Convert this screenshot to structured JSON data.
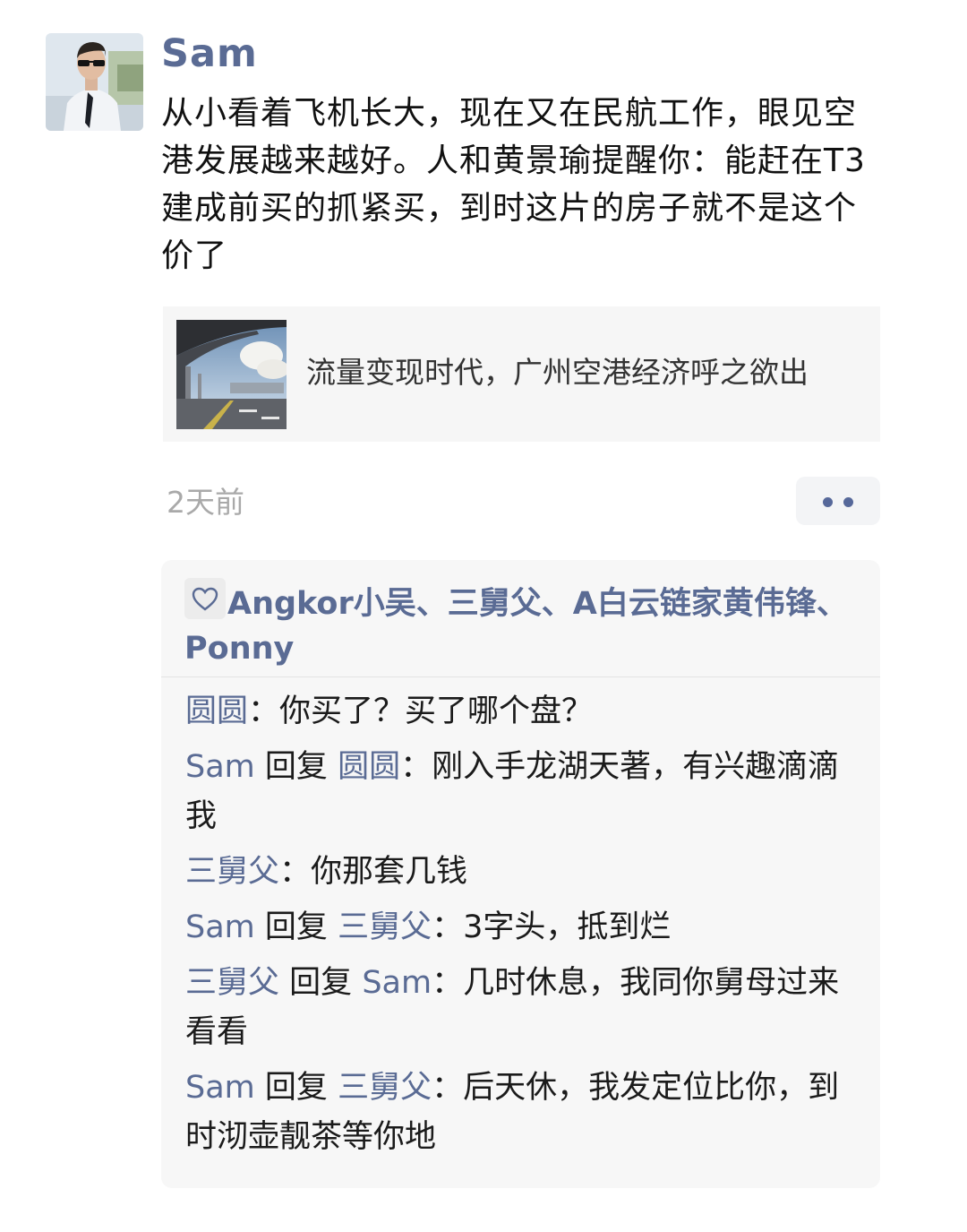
{
  "post": {
    "author": "Sam",
    "text": "从小看着飞机长大，现在又在民航工作，眼见空港发展越来越好。人和黄景瑜提醒你：能赶在T3建成前买的抓紧买，到时这片的房子就不是这个价了",
    "link_title": "流量变现时代，广州空港经济呼之欲出",
    "time": "2天前"
  },
  "likes": {
    "names": [
      "Angkor小吴",
      "三舅父",
      "A白云链家黄伟锋",
      "Ponny"
    ],
    "separator": "、"
  },
  "comments": {
    "reply_word": "回复",
    "colon": "：",
    "items": [
      {
        "from": "圆圆",
        "to": "",
        "text": "你买了？买了哪个盘？"
      },
      {
        "from": "Sam",
        "to": "圆圆",
        "text": "刚入手龙湖天著，有兴趣滴滴我"
      },
      {
        "from": "三舅父",
        "to": "",
        "text": "你那套几钱"
      },
      {
        "from": "Sam",
        "to": "三舅父",
        "text": "3字头，抵到烂"
      },
      {
        "from": "三舅父",
        "to": "Sam",
        "text": "几时休息，我同你舅母过来看看"
      },
      {
        "from": "Sam",
        "to": "三舅父",
        "text": "后天休，我发定位比你，到时沏壶靓茶等你地"
      }
    ]
  },
  "icons": {
    "avatar": "avatar-photo-man-in-uniform",
    "thumb": "airport-terminal-photo",
    "like": "heart-outline-icon",
    "more": "more-dots-icon"
  },
  "colors": {
    "name_blue": "#5a6b94",
    "time_gray": "#a9a9a9",
    "card_bg": "#f6f6f6",
    "comment_bg": "#f7f7f7"
  }
}
